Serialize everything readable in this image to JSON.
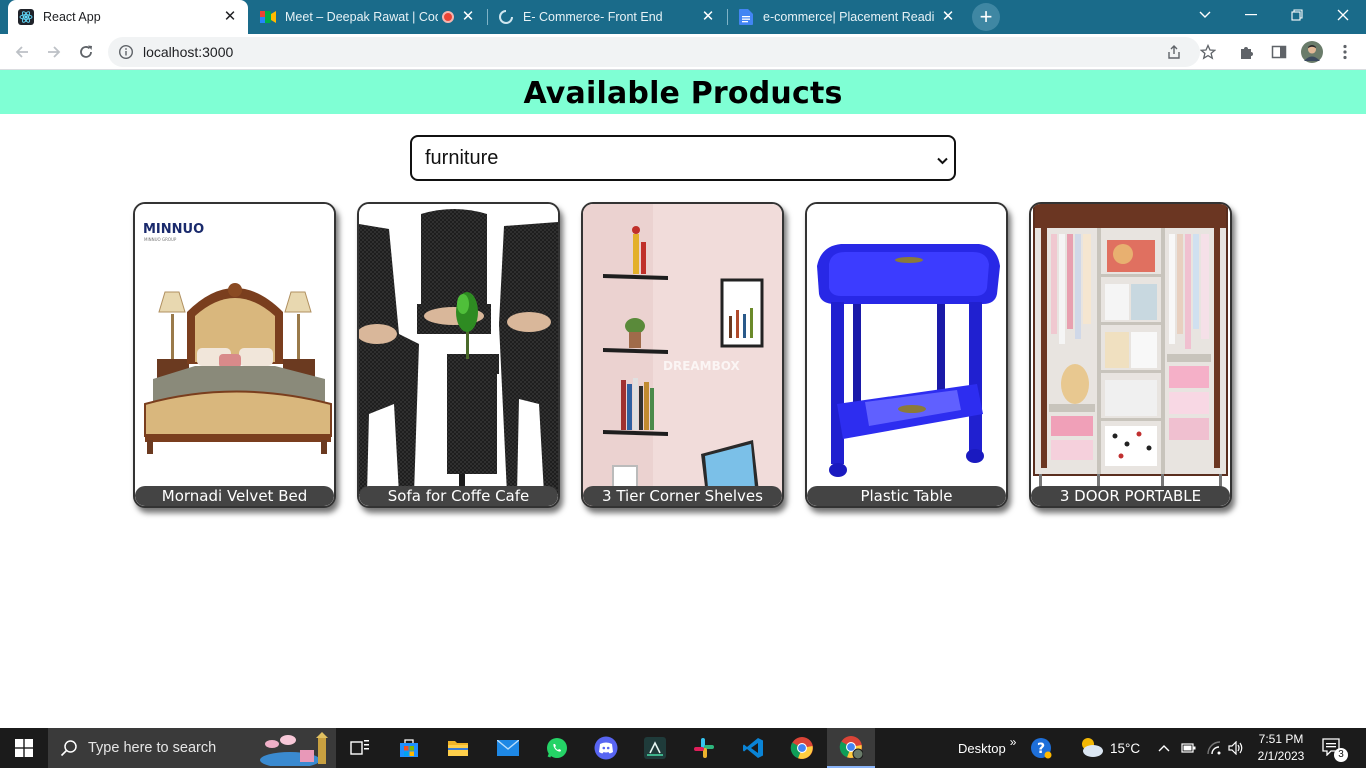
{
  "browser": {
    "tabs": [
      {
        "title": "React App",
        "active": true
      },
      {
        "title": "Meet – Deepak Rawat | Codi",
        "active": false
      },
      {
        "title": "E- Commerce- Front End",
        "active": false
      },
      {
        "title": "e-commerce| Placement Readine",
        "active": false
      }
    ],
    "url": "localhost:3000"
  },
  "page": {
    "heading": "Available Products",
    "category_select": {
      "selected": "furniture"
    },
    "products": [
      {
        "name": "Mornadi Velvet Bed"
      },
      {
        "name": "Sofa for Coffe Cafe"
      },
      {
        "name": "3 Tier Corner Shelves"
      },
      {
        "name": "Plastic Table"
      },
      {
        "name": "3 DOOR PORTABLE"
      }
    ],
    "image_texts": {
      "bed_brand": "MINNUO",
      "bed_brand_sub": "MINNUO GROUP",
      "shelves_watermark": "DREAMBOX"
    }
  },
  "taskbar": {
    "search_placeholder": "Type here to search",
    "desktop_label": "Desktop",
    "weather": "15°C",
    "time": "7:51 PM",
    "date": "2/1/2023",
    "notification_count": "3"
  },
  "colors": {
    "tab_strip": "#1a6b8a",
    "banner": "#7fffd4",
    "caption_bg": "#444444"
  }
}
